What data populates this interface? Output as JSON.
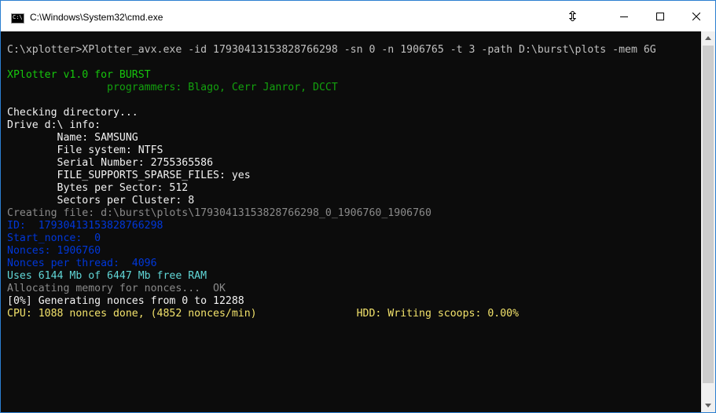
{
  "window": {
    "title": "C:\\Windows\\System32\\cmd.exe",
    "app_icon_glyph": "C:\\",
    "icons": {
      "app": "cmd-icon",
      "resize_cursor": "resize-cursor-icon",
      "minimize": "minimize-icon",
      "maximize": "maximize-icon",
      "close": "close-icon"
    }
  },
  "console": {
    "background": "#0c0c0c",
    "lines": [
      {
        "text": "C:\\xplotter>XPlotter_avx.exe -id 17930413153828766298 -sn 0 -n 1906765 -t 3 -path D:\\burst\\plots -mem 6G",
        "color": "c-gray"
      },
      {
        "text": "",
        "color": "c-gray"
      },
      {
        "text": "XPlotter v1.0 for BURST",
        "color": "c-green"
      },
      {
        "text": "                programmers: Blago, Cerr Janror, DCCT",
        "color": "c-darkgreen"
      },
      {
        "text": "",
        "color": "c-gray"
      },
      {
        "text": "Checking directory...",
        "color": "c-white"
      },
      {
        "text": "Drive d:\\ info:",
        "color": "c-white"
      },
      {
        "text": "        Name: SAMSUNG",
        "color": "c-white"
      },
      {
        "text": "        File system: NTFS",
        "color": "c-white"
      },
      {
        "text": "        Serial Number: 2755365586",
        "color": "c-white"
      },
      {
        "text": "        FILE_SUPPORTS_SPARSE_FILES: yes",
        "color": "c-white"
      },
      {
        "text": "        Bytes per Sector: 512",
        "color": "c-white"
      },
      {
        "text": "        Sectors per Cluster: 8",
        "color": "c-white"
      },
      {
        "text": "Creating file: d:\\burst\\plots\\17930413153828766298_0_1906760_1906760",
        "color": "c-dimgray"
      },
      {
        "text": "ID:  17930413153828766298",
        "color": "c-blue"
      },
      {
        "text": "Start_nonce:  0",
        "color": "c-blue"
      },
      {
        "text": "Nonces: 1906760",
        "color": "c-blue"
      },
      {
        "text": "Nonces per thread:  4096",
        "color": "c-blue"
      },
      {
        "text": "Uses 6144 Mb of 6447 Mb free RAM",
        "color": "c-teal"
      },
      {
        "text": "Allocating memory for nonces...  OK",
        "color": "c-dimgray"
      },
      {
        "text": "[0%] Generating nonces from 0 to 12288",
        "color": "c-white"
      },
      {
        "text": "CPU: 1088 nonces done, (4852 nonces/min)                HDD: Writing scoops: 0.00%",
        "color": "c-gold"
      }
    ]
  }
}
